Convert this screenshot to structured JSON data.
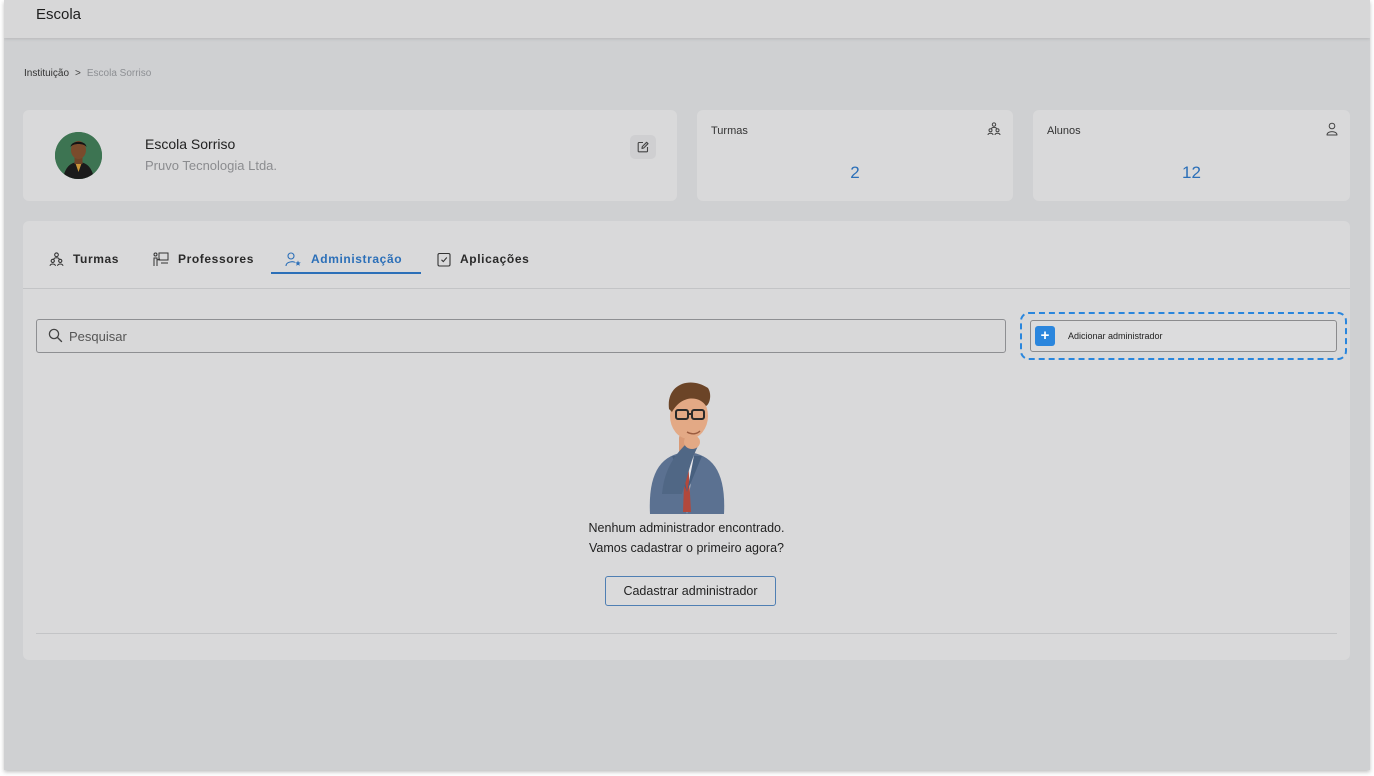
{
  "app": {
    "title": "Escola"
  },
  "breadcrumb": {
    "root": "Instituição",
    "separator": ">",
    "current": "Escola Sorriso"
  },
  "school": {
    "name": "Escola Sorriso",
    "organization": "Pruvo Tecnologia Ltda.",
    "edit_icon": "edit-icon"
  },
  "stats": {
    "turmas": {
      "label": "Turmas",
      "value": "2",
      "icon": "group-icon"
    },
    "alunos": {
      "label": "Alunos",
      "value": "12",
      "icon": "user-icon"
    }
  },
  "tabs": [
    {
      "label": "Turmas",
      "icon": "group-icon",
      "active": false
    },
    {
      "label": "Professores",
      "icon": "presentation-board-icon",
      "active": false
    },
    {
      "label": "Administração",
      "icon": "user-star-icon",
      "active": true
    },
    {
      "label": "Aplicações",
      "icon": "checklist-icon",
      "active": false
    }
  ],
  "search": {
    "placeholder": "Pesquisar",
    "value": ""
  },
  "add_admin": {
    "label": "Adicionar administrador",
    "icon": "plus-icon"
  },
  "empty_state": {
    "line1": "Nenhum administrador encontrado.",
    "line2": "Vamos cadastrar o primeiro agora?",
    "button": "Cadastrar administrador"
  },
  "colors": {
    "accent": "#2b6fb8",
    "button_blue": "#2b86dd",
    "background": "#cfd0d2"
  }
}
